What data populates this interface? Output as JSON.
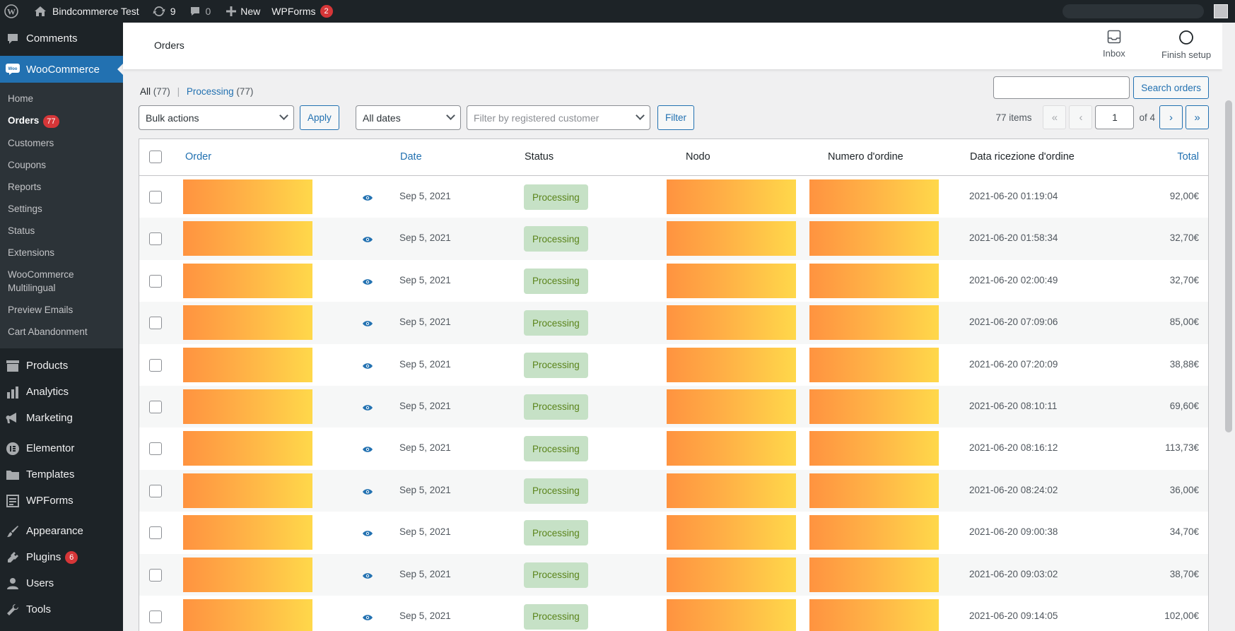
{
  "adminbar": {
    "site_name": "Bindcommerce Test",
    "updates_count": "9",
    "comments_count": "0",
    "new_label": "New",
    "wpforms_label": "WPForms",
    "wpforms_badge": "2"
  },
  "sidebar": {
    "comments": "Comments",
    "woocommerce": "WooCommerce",
    "sub": {
      "home": "Home",
      "orders": "Orders",
      "orders_badge": "77",
      "customers": "Customers",
      "coupons": "Coupons",
      "reports": "Reports",
      "settings": "Settings",
      "status": "Status",
      "extensions": "Extensions",
      "multilingual_1": "WooCommerce",
      "multilingual_2": "Multilingual",
      "preview_emails": "Preview Emails",
      "cart_abandonment": "Cart Abandonment"
    },
    "products": "Products",
    "analytics": "Analytics",
    "marketing": "Marketing",
    "elementor": "Elementor",
    "templates": "Templates",
    "wpforms": "WPForms",
    "appearance": "Appearance",
    "plugins": "Plugins",
    "plugins_badge": "6",
    "users": "Users",
    "tools": "Tools"
  },
  "header": {
    "title": "Orders",
    "inbox": "Inbox",
    "finish_setup": "Finish setup"
  },
  "views": {
    "all_label": "All",
    "all_count": "(77)",
    "processing_label": "Processing",
    "processing_count": "(77)"
  },
  "search": {
    "button": "Search orders",
    "value": ""
  },
  "filters": {
    "bulk_actions": "Bulk actions",
    "apply": "Apply",
    "all_dates": "All dates",
    "customer_placeholder": "Filter by registered customer",
    "filter": "Filter"
  },
  "pagination": {
    "items": "77 items",
    "first": "«",
    "prev": "‹",
    "current_page": "1",
    "of_pages": "of 4",
    "next": "›",
    "last": "»"
  },
  "columns": {
    "order": "Order",
    "date": "Date",
    "status": "Status",
    "nodo": "Nodo",
    "numero": "Numero d'ordine",
    "data_ricezione": "Data ricezione d'ordine",
    "total": "Total"
  },
  "rows": [
    {
      "date": "Sep 5, 2021",
      "status": "Processing",
      "received": "2021-06-20 01:19:04",
      "total": "92,00€"
    },
    {
      "date": "Sep 5, 2021",
      "status": "Processing",
      "received": "2021-06-20 01:58:34",
      "total": "32,70€"
    },
    {
      "date": "Sep 5, 2021",
      "status": "Processing",
      "received": "2021-06-20 02:00:49",
      "total": "32,70€"
    },
    {
      "date": "Sep 5, 2021",
      "status": "Processing",
      "received": "2021-06-20 07:09:06",
      "total": "85,00€"
    },
    {
      "date": "Sep 5, 2021",
      "status": "Processing",
      "received": "2021-06-20 07:20:09",
      "total": "38,88€"
    },
    {
      "date": "Sep 5, 2021",
      "status": "Processing",
      "received": "2021-06-20 08:10:11",
      "total": "69,60€"
    },
    {
      "date": "Sep 5, 2021",
      "status": "Processing",
      "received": "2021-06-20 08:16:12",
      "total": "113,73€"
    },
    {
      "date": "Sep 5, 2021",
      "status": "Processing",
      "received": "2021-06-20 08:24:02",
      "total": "36,00€"
    },
    {
      "date": "Sep 5, 2021",
      "status": "Processing",
      "received": "2021-06-20 09:00:38",
      "total": "34,70€"
    },
    {
      "date": "Sep 5, 2021",
      "status": "Processing",
      "received": "2021-06-20 09:03:02",
      "total": "38,70€"
    },
    {
      "date": "Sep 5, 2021",
      "status": "Processing",
      "received": "2021-06-20 09:14:05",
      "total": "102,00€"
    }
  ],
  "colors": {
    "adminbar_bg": "#1d2327",
    "accent": "#2271b1",
    "status_bg": "#c6e1c6",
    "status_text": "#5b841b",
    "badge_red": "#d63638"
  }
}
